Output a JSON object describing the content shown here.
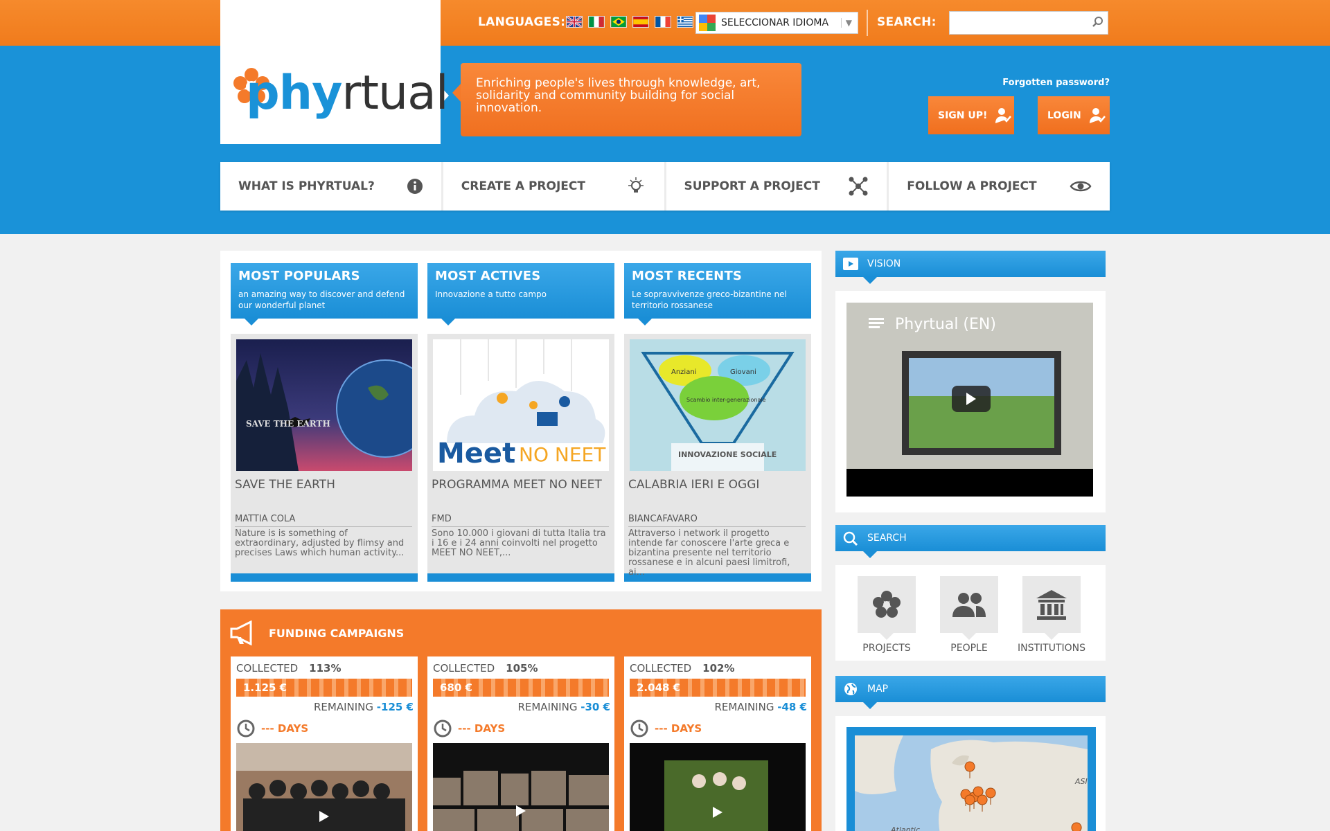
{
  "header": {
    "languages_label": "LANGUAGES:",
    "lang_select_label": "SELECCIONAR IDIOMA",
    "search_label": "SEARCH:",
    "search_placeholder": ""
  },
  "tagline": "Enriching people's lives through knowledge, art, solidarity and community building for social innovation.",
  "auth": {
    "forgot": "Forgotten password?",
    "signup": "SIGN UP!",
    "login": "LOGIN"
  },
  "nav": [
    {
      "label": "WHAT IS PHYRTUAL?"
    },
    {
      "label": "CREATE A PROJECT"
    },
    {
      "label": "SUPPORT A PROJECT"
    },
    {
      "label": "FOLLOW A PROJECT"
    }
  ],
  "cards": [
    {
      "heading": "MOST POPULARS",
      "sub": "an amazing way to discover and defend our wonderful planet",
      "title": "SAVE THE EARTH",
      "author": "MATTIA COLA",
      "desc": "Nature is is something of extraordinary, adjusted by flimsy and precises Laws which human activity..."
    },
    {
      "heading": "MOST ACTIVES",
      "sub": "Innovazione a tutto campo",
      "title": "PROGRAMMA MEET NO NEET",
      "author": "FMD",
      "desc": "Sono 10.000 i giovani di tutta Italia tra i 16 e i 24 anni coinvolti nel progetto MEET NO NEET,..."
    },
    {
      "heading": "MOST RECENTS",
      "sub": "Le sopravvivenze greco-bizantine nel territorio rossanese",
      "title": "CALABRIA IERI E OGGI",
      "author": "BIANCAFAVARO",
      "desc": "Attraverso i network il progetto intende far conoscere l'arte greca e bizantina presente nel territorio rossanese e in alcuni paesi limitrofi, ai..."
    }
  ],
  "card_images": {
    "earth_text": "SAVE THE EARTH",
    "meet_text_a": "Meet",
    "meet_text_b": "NO NEET",
    "innov_a": "Anziani",
    "innov_b": "Giovani",
    "innov_c": "Scambio inter-generazionale",
    "innov_d": "INNOVAZIONE SOCIALE"
  },
  "funding": {
    "title": "FUNDING CAMPAIGNS",
    "collected_label": "COLLECTED",
    "remaining_label": "REMAINING",
    "items": [
      {
        "pct": "113%",
        "amount": "1.125 €",
        "remaining": "-125 €",
        "days": "--- DAYS"
      },
      {
        "pct": "105%",
        "amount": "680 €",
        "remaining": "-30 €",
        "days": "--- DAYS"
      },
      {
        "pct": "102%",
        "amount": "2.048 €",
        "remaining": "-48 €",
        "days": "--- DAYS"
      }
    ]
  },
  "sidebar": {
    "vision": "VISION",
    "video_title": "Phyrtual (EN)",
    "search": "SEARCH",
    "search_items": [
      "PROJECTS",
      "PEOPLE",
      "INSTITUTIONS"
    ],
    "map": "MAP",
    "map_labels": [
      "Atlantic",
      "ASI"
    ]
  },
  "colors": {
    "orange": "#f47a2a",
    "blue": "#1a92d8"
  }
}
